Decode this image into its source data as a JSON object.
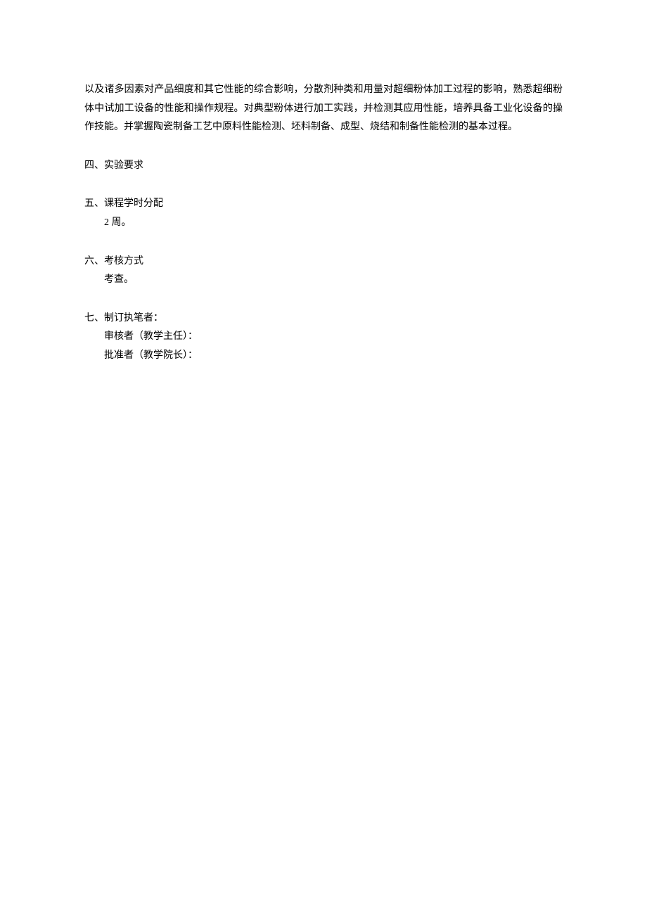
{
  "intro_paragraph": "以及诸多因素对产品细度和其它性能的综合影响，分散剂种类和用量对超细粉体加工过程的影响，熟悉超细粉体中试加工设备的性能和操作规程。对典型粉体进行加工实践，并检测其应用性能，培养具备工业化设备的操作技能。并掌握陶瓷制备工艺中原料性能检测、坯料制备、成型、烧结和制备性能检测的基本过程。",
  "section4": {
    "title": "四、实验要求"
  },
  "section5": {
    "title": "五、课程学时分配",
    "content_prefix": "2",
    "content_suffix": " 周。"
  },
  "section6": {
    "title": "六、考核方式",
    "content": "考查。"
  },
  "section7": {
    "title": "七、制订执笔者：",
    "line1": "审核者（教学主任）：",
    "line2": "批准者（教学院长）："
  }
}
